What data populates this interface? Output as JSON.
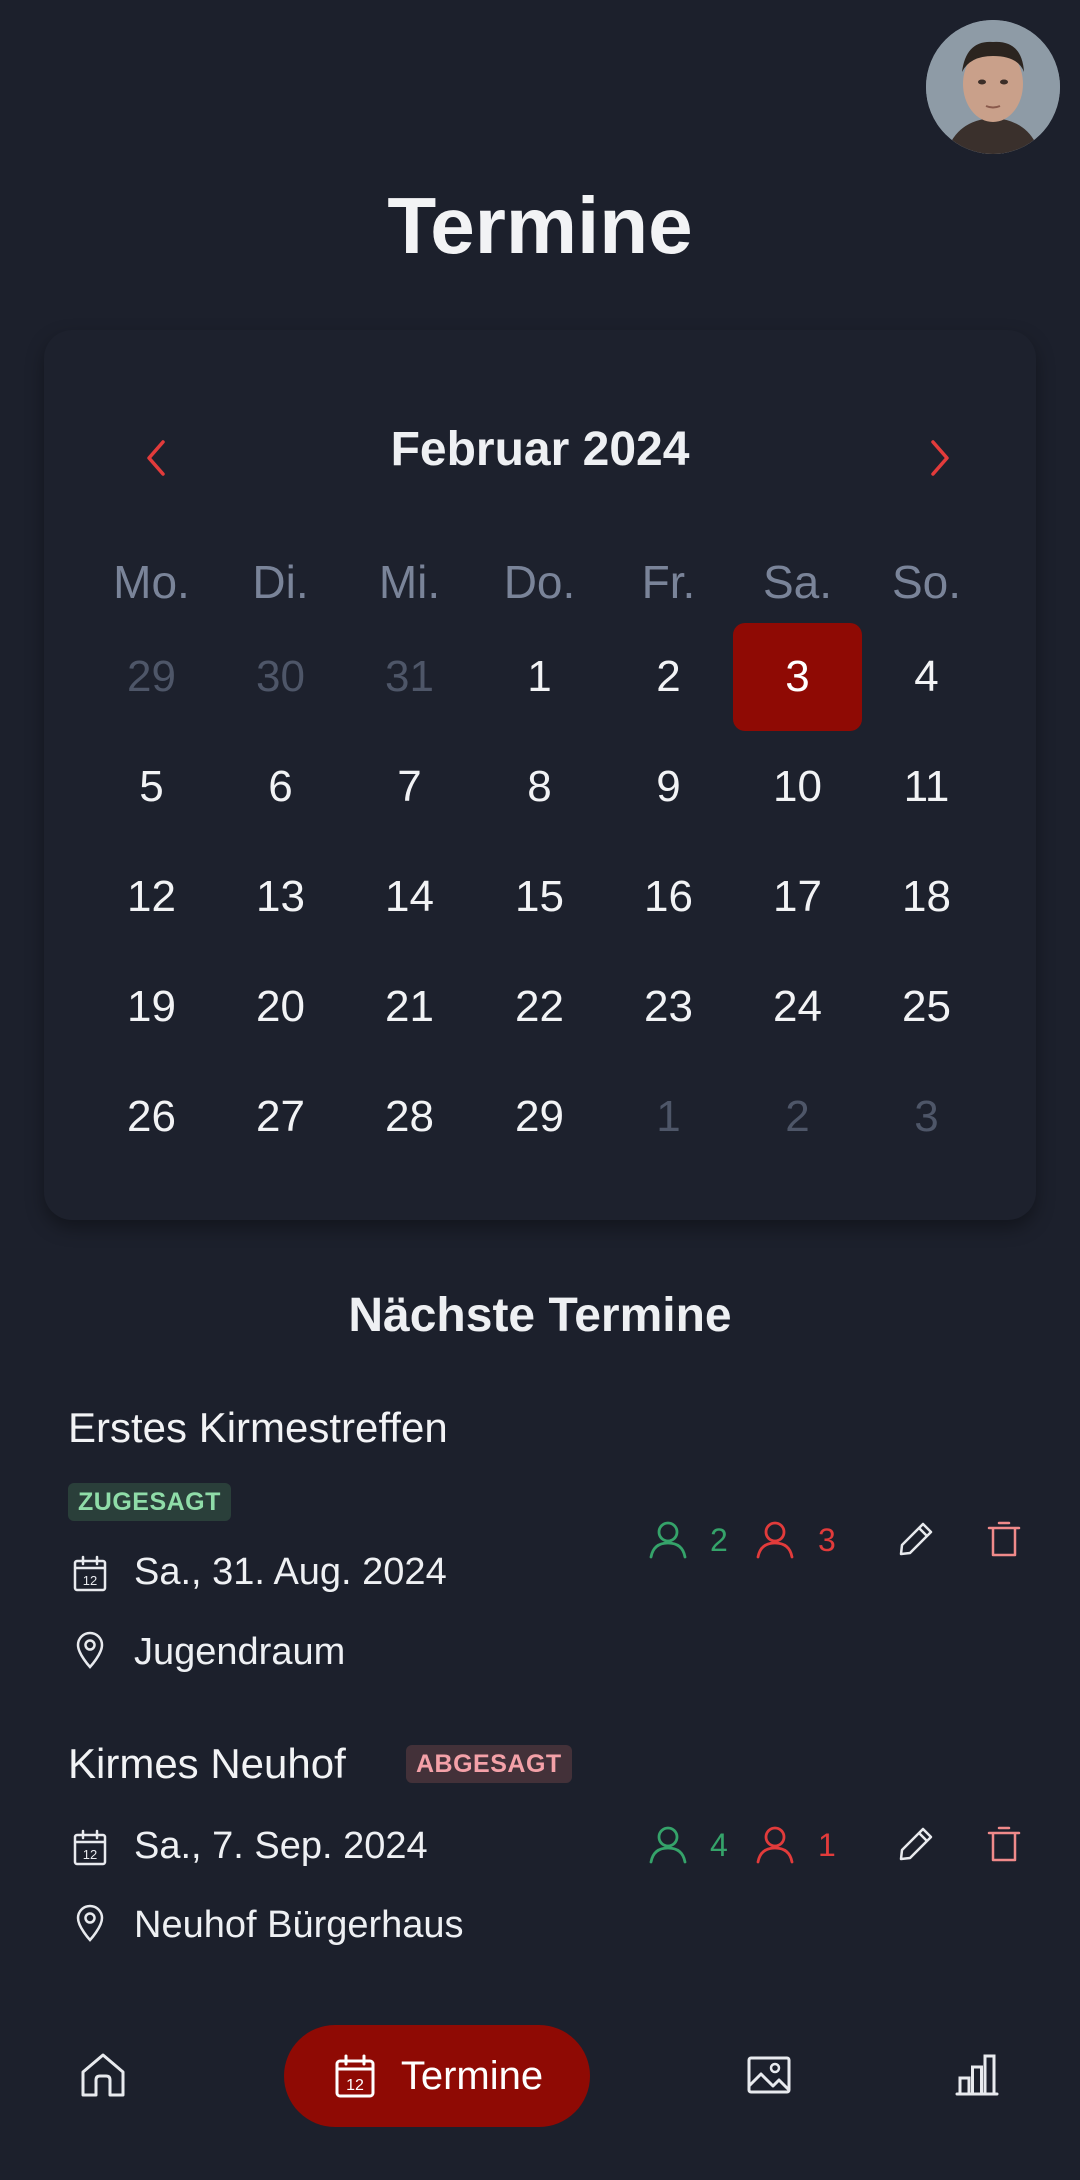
{
  "header": {
    "title": "Termine"
  },
  "calendar": {
    "month_title": "Februar 2024",
    "weekdays": [
      "Mo.",
      "Di.",
      "Mi.",
      "Do.",
      "Fr.",
      "Sa.",
      "So."
    ],
    "weeks": [
      [
        "29",
        "30",
        "31",
        "1",
        "2",
        "3",
        "4"
      ],
      [
        "5",
        "6",
        "7",
        "8",
        "9",
        "10",
        "11"
      ],
      [
        "12",
        "13",
        "14",
        "15",
        "16",
        "17",
        "18"
      ],
      [
        "19",
        "20",
        "21",
        "22",
        "23",
        "24",
        "25"
      ],
      [
        "26",
        "27",
        "28",
        "29",
        "1",
        "2",
        "3"
      ]
    ],
    "selected_day": "3",
    "accent_color": "#8f0a04"
  },
  "upcoming": {
    "title": "Nächste Termine",
    "events": [
      {
        "title": "Erstes Kirmestreffen",
        "status": "ZUGESAGT",
        "date": "Sa., 31. Aug. 2024",
        "location": "Jugendraum",
        "accepted": "2",
        "declined": "3"
      },
      {
        "title": "Kirmes Neuhof",
        "status": "ABGESAGT",
        "date": "Sa., 7. Sep. 2024",
        "location": "Neuhof Bürgerhaus",
        "accepted": "4",
        "declined": "1"
      }
    ]
  },
  "nav": {
    "items": [
      "home-icon",
      "calendar-icon",
      "image-icon",
      "bar-chart-icon"
    ],
    "active_label": "Termine",
    "calendar_icon_number": "12"
  },
  "colors": {
    "background": "#1c202c",
    "accent": "#8f0a04",
    "green": "#35a36a",
    "red": "#e23b3b"
  }
}
